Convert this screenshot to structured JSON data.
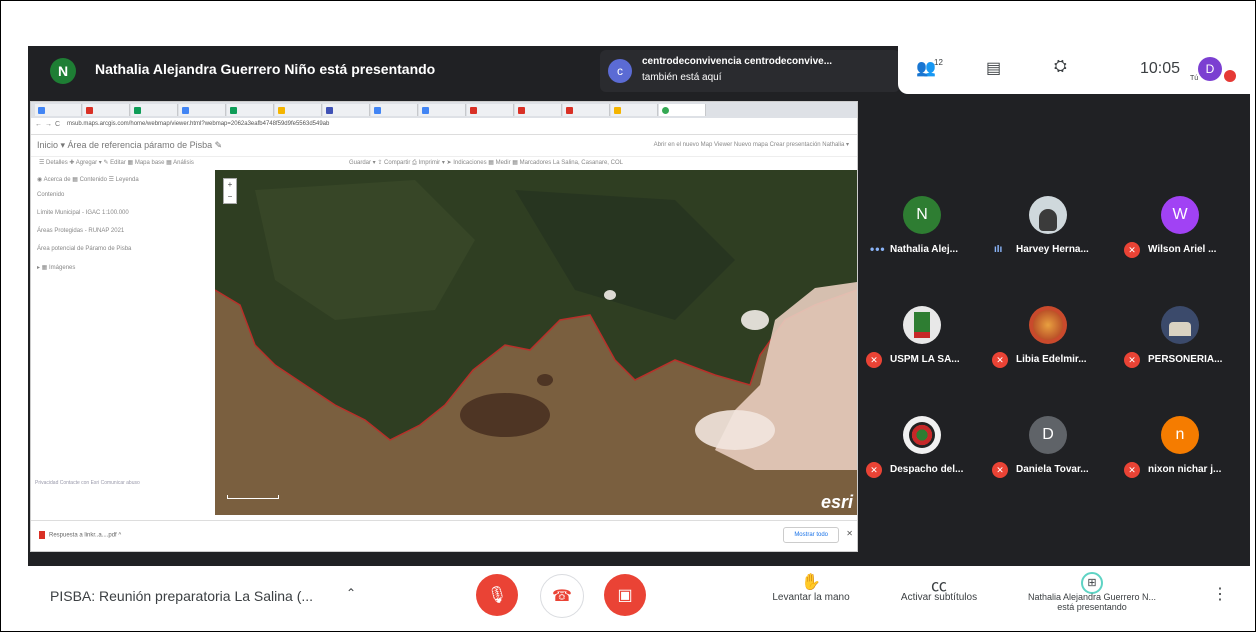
{
  "presenter": {
    "initial": "N",
    "title": "Nathalia Alejandra Guerrero Niño está presentando"
  },
  "also_here": {
    "initial": "c",
    "name": "centrodeconvivencia centrodeconvive...",
    "sub": "también está aquí"
  },
  "top_controls": {
    "people_count": "12",
    "time": "10:05",
    "you_label": "Tú",
    "me_initial": "D"
  },
  "shared_screen": {
    "url": "msub.maps.arcgis.com/home/webmap/viewer.html?webmap=2062a3eafb4748f59d9fe5563d549ab",
    "map_title": "Inicio ▾   Área de referencia páramo de Pisba ✎",
    "header_links": "Abrir en el nuevo Map Viewer   Nuevo mapa   Crear presentación   Nathalia ▾",
    "toolbar_left": "☰ Detalles   ✚ Agregar ▾   ✎ Editar   ▦ Mapa base   ▦ Análisis",
    "toolbar_right": "Guardar ▾   ⇪ Compartir   ⎙ Imprimir ▾   ➤ Indicaciones   ▦ Medir   ▦ Marcadores   La Salina, Casanare, COL",
    "sidebar_tabs": "◉ Acerca de   ▦ Contenido   ☰ Leyenda",
    "sidebar_heading": "Contenido",
    "layers": [
      "Límite Municipal - IGAC 1:100.000",
      "Áreas Protegidas - RUNAP 2021",
      "Área potencial de Páramo de Pisba",
      "▸ ▦ Imágenes"
    ],
    "sidebar_footer": "Privacidad   Contacte con Esri   Comunicar abuso",
    "download_item": "Respuesta a linkr..a....pdf  ^",
    "show_all": "Mostrar todo",
    "esri": "esri"
  },
  "participants": [
    {
      "initial": "N",
      "name": "Nathalia Alej...",
      "color": "#2e7d32",
      "status": "dots"
    },
    {
      "initial": "",
      "name": "Harvey Herna...",
      "color": "#cfd8dc",
      "status": "speaking"
    },
    {
      "initial": "W",
      "name": "Wilson Ariel ...",
      "color": "#a142f4",
      "status": "muted"
    },
    {
      "initial": "",
      "name": "USPM LA SA...",
      "color": "#e8e8e8",
      "status": "muted"
    },
    {
      "initial": "",
      "name": "Libia Edelmir...",
      "color": "#c94a2c",
      "status": "muted"
    },
    {
      "initial": "",
      "name": "PERSONERIA...",
      "color": "#3b4a6b",
      "status": "muted"
    },
    {
      "initial": "",
      "name": "Despacho del...",
      "color": "#f1f1f1",
      "status": "muted"
    },
    {
      "initial": "D",
      "name": "Daniela Tovar...",
      "color": "#5f6368",
      "status": "muted"
    },
    {
      "initial": "n",
      "name": "nixon nichar j...",
      "color": "#f57c00",
      "status": "muted"
    }
  ],
  "bottom": {
    "meeting_title": "PISBA: Reunión preparatoria La Salina (...",
    "raise_hand": "Levantar la mano",
    "captions": "Activar subtítulos",
    "presenting_line1": "Nathalia Alejandra Guerrero N...",
    "presenting_line2": "está presentando"
  }
}
